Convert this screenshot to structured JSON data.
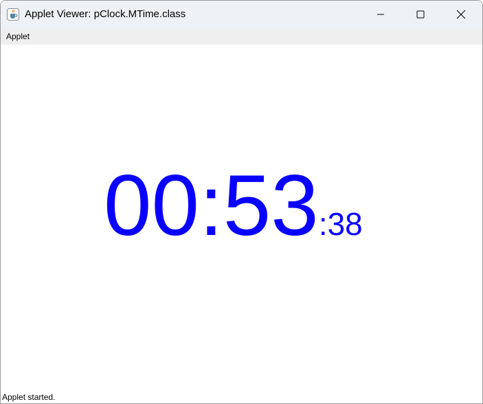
{
  "window": {
    "title": "Applet Viewer: pClock.MTime.class",
    "icon": "java-cup-icon",
    "controls": [
      "minimize-icon",
      "maximize-icon",
      "close-icon"
    ]
  },
  "menubar": {
    "items": [
      {
        "label": "Applet"
      }
    ]
  },
  "clock": {
    "hours_minutes": "00:53",
    "seconds": ":38",
    "color": "#0a00ff"
  },
  "status": {
    "text": "Applet started."
  }
}
